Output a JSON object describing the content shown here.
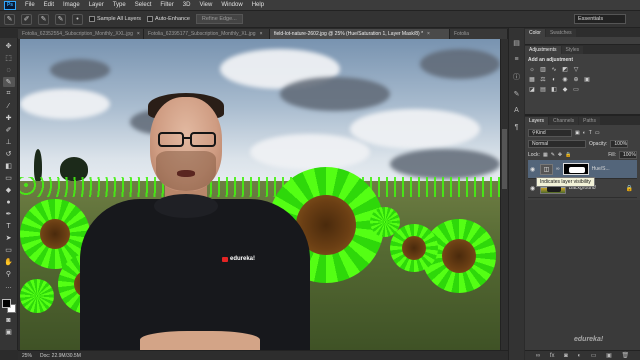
{
  "app": {
    "logo": "Ps",
    "menu": [
      "File",
      "Edit",
      "Image",
      "Layer",
      "Type",
      "Select",
      "Filter",
      "3D",
      "View",
      "Window",
      "Help"
    ]
  },
  "options": {
    "sample_all_layers": "Sample All Layers",
    "auto_enhance": "Auto-Enhance",
    "refine_edge": "Refine Edge...",
    "workspace": "Essentials"
  },
  "tabs": [
    {
      "label": "Fotolia_62352554_Subscription_Monthly_XXL.jpg",
      "close": "×"
    },
    {
      "label": "Fotolia_62395177_Subscription_Monthly_XL.jpg",
      "close": "×"
    },
    {
      "label": "field-lot-nature-2602.jpg @ 25% (Hue/Saturation 1, Layer Mask/8) *",
      "close": "×"
    },
    {
      "label": "Fotolia",
      "close": ""
    }
  ],
  "status": {
    "zoom": "25%",
    "doc": "Doc: 22.9M/30.5M"
  },
  "overlay": {
    "brand": "edureka!"
  },
  "panels": {
    "color_tabs": [
      "Color",
      "Swatches"
    ],
    "adj_tabs": [
      "Adjustments",
      "Styles"
    ],
    "adj_title": "Add an adjustment",
    "layer_tabs": [
      "Layers",
      "Channels",
      "Paths"
    ],
    "kind": "Kind",
    "blend_mode": "Normal",
    "opacity_label": "Opacity:",
    "opacity_value": "100%",
    "lock_label": "Lock:",
    "fill_label": "Fill:",
    "fill_value": "100%",
    "layers": [
      {
        "name": "Hue/S...",
        "type": "adjustment"
      },
      {
        "name": "Background",
        "type": "image"
      }
    ],
    "tooltip": "Indicates layer visibility"
  },
  "watermark": "edureka!"
}
